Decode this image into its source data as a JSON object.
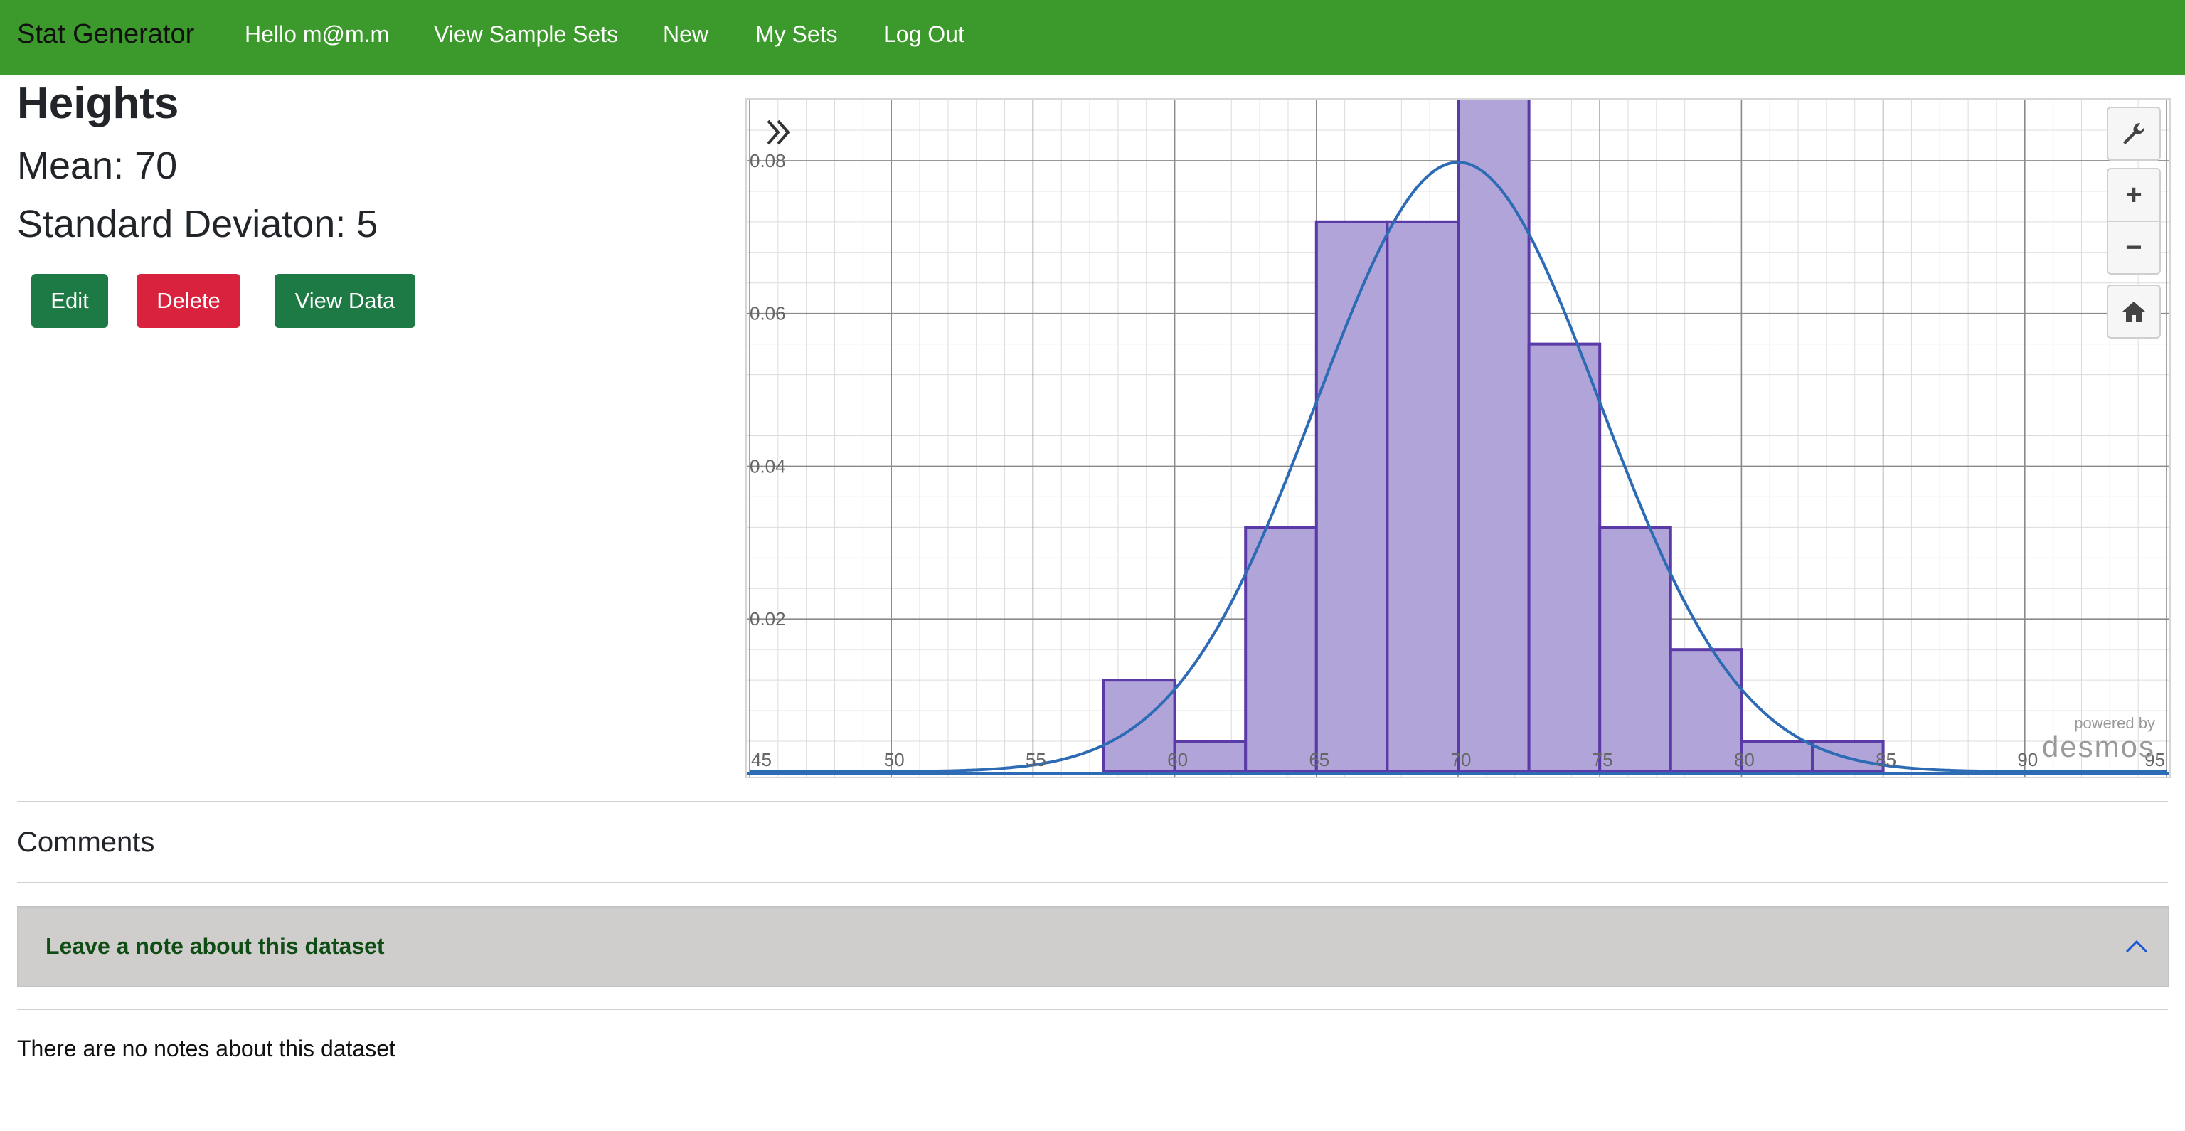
{
  "nav": {
    "brand": "Stat Generator",
    "links": [
      "Hello m@m.m",
      "View Sample Sets",
      "New",
      "My Sets",
      "Log Out"
    ]
  },
  "dataset": {
    "title": "Heights",
    "mean_text": "Mean: 70",
    "sd_text": "Standard Deviaton: 5"
  },
  "buttons": {
    "edit": "Edit",
    "delete": "Delete",
    "view_data": "View Data"
  },
  "graph": {
    "powered_small": "powered by",
    "powered_brand": "desmos",
    "tools": [
      "wrench-icon",
      "zoom-in-icon",
      "zoom-out-icon",
      "home-icon"
    ]
  },
  "chart_data": {
    "type": "bar",
    "x_range": [
      45,
      95
    ],
    "y_range": [
      0,
      0.088
    ],
    "x_ticks": [
      "45",
      "50",
      "55",
      "60",
      "65",
      "70",
      "75",
      "80",
      "85",
      "90",
      "95"
    ],
    "y_ticks": [
      "0.02",
      "0.04",
      "0.06",
      "0.08"
    ],
    "bins": [
      {
        "x0": 57.5,
        "x1": 60,
        "density": 0.012
      },
      {
        "x0": 60,
        "x1": 62.5,
        "density": 0.004
      },
      {
        "x0": 62.5,
        "x1": 65,
        "density": 0.032
      },
      {
        "x0": 65,
        "x1": 67.5,
        "density": 0.072
      },
      {
        "x0": 67.5,
        "x1": 70,
        "density": 0.072
      },
      {
        "x0": 70,
        "x1": 72.5,
        "density": 0.096
      },
      {
        "x0": 72.5,
        "x1": 75,
        "density": 0.056
      },
      {
        "x0": 75,
        "x1": 77.5,
        "density": 0.032
      },
      {
        "x0": 77.5,
        "x1": 80,
        "density": 0.016
      },
      {
        "x0": 80,
        "x1": 82.5,
        "density": 0.004
      },
      {
        "x0": 82.5,
        "x1": 85,
        "density": 0.004
      }
    ],
    "curve": {
      "type": "normal",
      "mean": 70,
      "sd": 5
    },
    "colors": {
      "bar_fill": "#b0a4d9",
      "bar_stroke": "#5a3aa6",
      "curve": "#2d6bb5"
    }
  },
  "comments": {
    "heading": "Comments",
    "accordion_label": "Leave a note about this dataset",
    "empty_text": "There are no notes about this dataset"
  }
}
